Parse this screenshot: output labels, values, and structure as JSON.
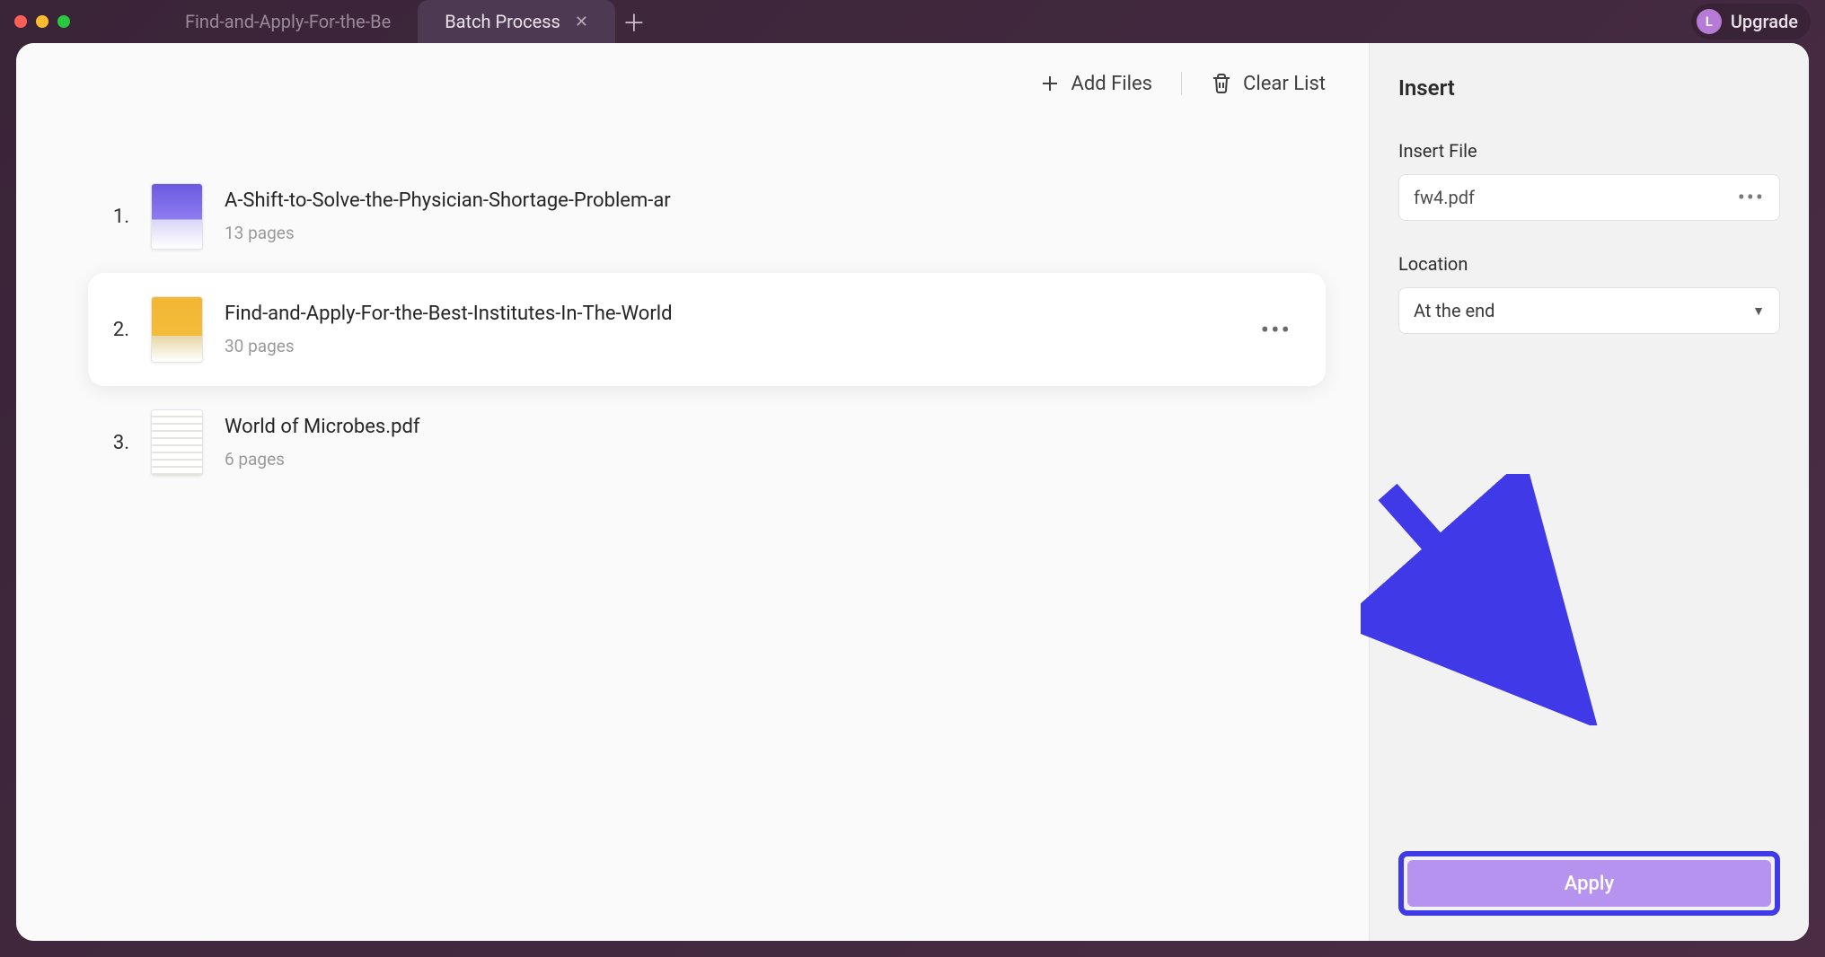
{
  "tabs": [
    {
      "title": "Find-and-Apply-For-the-Be",
      "active": false
    },
    {
      "title": "Batch Process",
      "active": true
    }
  ],
  "upgrade": {
    "initial": "L",
    "label": "Upgrade"
  },
  "toolbar": {
    "add_files": "Add Files",
    "clear_list": "Clear List"
  },
  "files": [
    {
      "index": "1.",
      "title": "A-Shift-to-Solve-the-Physician-Shortage-Problem-ar",
      "pages": "13 pages",
      "selected": false,
      "thumb_bg": "linear-gradient(180deg,#6b5ae0 0%,#8e7df0 55%,#d9d5f6 55%,#ffffff 100%)"
    },
    {
      "index": "2.",
      "title": "Find-and-Apply-For-the-Best-Institutes-In-The-World",
      "pages": "30 pages",
      "selected": true,
      "thumb_bg": "linear-gradient(180deg,#f2b733 0%,#f3bc3b 60%,#e7d7a6 60%,#ffffff 100%)"
    },
    {
      "index": "3.",
      "title": "World of Microbes.pdf",
      "pages": "6 pages",
      "selected": false,
      "thumb_bg": "repeating-linear-gradient(180deg,#fff,#fff 6px,#e9e4da 6px,#e9e4da 8px)"
    }
  ],
  "side": {
    "title": "Insert",
    "file_label": "Insert File",
    "file_value": "fw4.pdf",
    "location_label": "Location",
    "location_value": "At the end",
    "apply_label": "Apply"
  },
  "colors": {
    "highlight_ring": "#4039e8",
    "apply_bg": "#b593ef",
    "arrow": "#4039e8"
  }
}
